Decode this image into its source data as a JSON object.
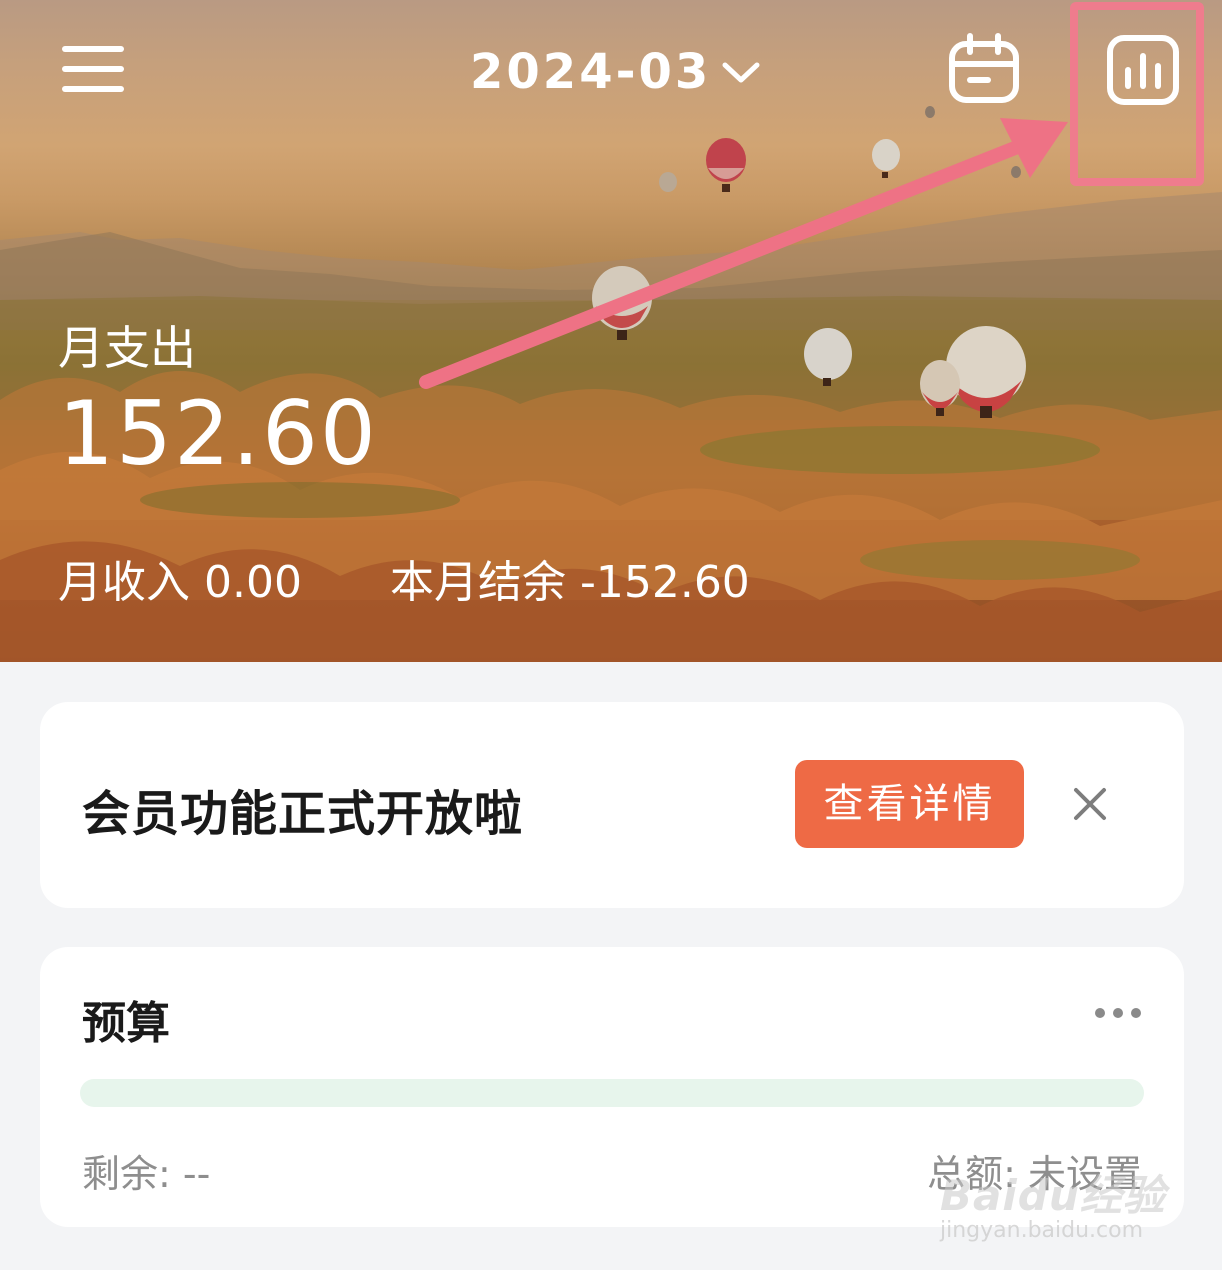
{
  "header": {
    "month": "2024-03",
    "menu_icon": "hamburger-menu-icon",
    "calendar_icon": "calendar-icon",
    "stats_icon": "bar-chart-icon"
  },
  "summary": {
    "expense_label": "月支出",
    "expense_value": "152.60",
    "income_label": "月收入",
    "income_value": "0.00",
    "balance_label": "本月结余",
    "balance_value": "-152.60"
  },
  "promo": {
    "title": "会员功能正式开放啦",
    "button_label": "查看详情",
    "close_icon": "close-icon"
  },
  "budget": {
    "title": "预算",
    "more_icon": "more-dots-icon",
    "progress": 0,
    "remaining_label": "剩余:",
    "remaining_value": "--",
    "total_label": "总额:",
    "total_value": "未设置"
  },
  "watermark": {
    "text": "Baidu经验",
    "url": "jingyan.baidu.com"
  },
  "colors": {
    "accent_button": "#ee6a45",
    "highlight": "#ef7c8d",
    "progress_track": "#e7f5ec",
    "page_background": "#f3f4f6"
  }
}
